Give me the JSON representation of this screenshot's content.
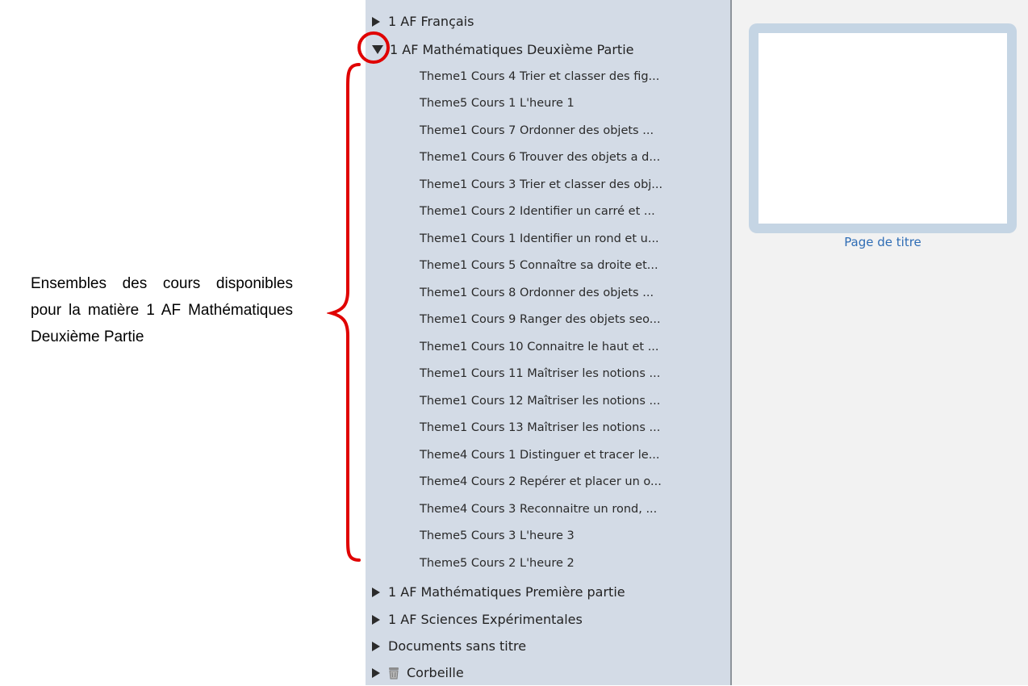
{
  "annotation": {
    "text": "Ensembles des cours disponibles pour la matière 1 AF Mathématiques Deuxième Partie"
  },
  "tree": {
    "top_items": [
      {
        "label": "1 AF Français",
        "icon": "triangle-right"
      },
      {
        "label": "1 AF Mathématiques Deuxième Partie",
        "icon": "triangle-down"
      },
      {
        "label": "1 AF Mathématiques Première partie",
        "icon": "triangle-right"
      },
      {
        "label": "1 AF Sciences Expérimentales",
        "icon": "triangle-right"
      },
      {
        "label": "Documents sans titre",
        "icon": "triangle-right"
      },
      {
        "label": "Corbeille",
        "icon": "trash-icon"
      }
    ],
    "courses": [
      "Theme1 Cours 4 Trier et classer des fig...",
      "Theme5 Cours 1 L'heure 1",
      "Theme1 Cours 7 Ordonner des objets ...",
      "Theme1 Cours 6 Trouver des objets a d...",
      "Theme1 Cours 3 Trier et classer des obj...",
      "Theme1 Cours 2 Identifier un carré et ...",
      "Theme1 Cours 1 Identifier un rond et u...",
      "Theme1 Cours 5 Connaître sa droite et...",
      "Theme1 Cours 8 Ordonner des objets ...",
      "Theme1 Cours 9 Ranger des objets seo...",
      "Theme1 Cours 10 Connaitre le haut et ...",
      "Theme1 Cours 11 Maîtriser les notions ...",
      "Theme1 Cours 12 Maîtriser les notions ...",
      "Theme1 Cours 13 Maîtriser les notions ...",
      "Theme4 Cours 1 Distinguer et tracer le...",
      "Theme4 Cours 2 Repérer et placer un o...",
      "Theme4 Cours 3 Reconnaitre un rond, ...",
      "Theme5 Cours 3 L'heure 3",
      "Theme5 Cours 2 L'heure 2"
    ]
  },
  "preview": {
    "label": "Page de titre"
  },
  "colors": {
    "sidebar": "#d3dbe6",
    "annotation_mark": "#e00000",
    "link": "#2f6db5"
  }
}
